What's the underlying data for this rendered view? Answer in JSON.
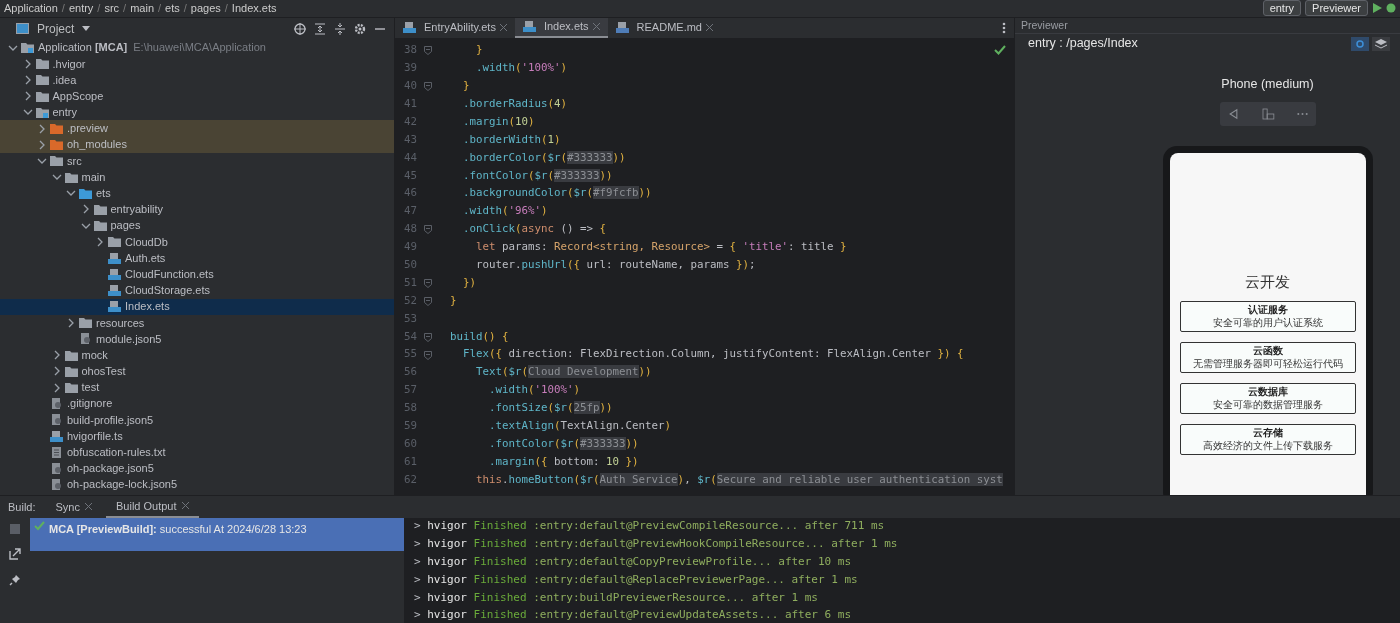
{
  "top_bar": {
    "separator": "/",
    "breadcrumb": [
      "Application",
      "entry",
      "src",
      "main",
      "ets",
      "pages",
      "Index.ets"
    ],
    "run_config": "entry",
    "device": "Previewer"
  },
  "project_panel": {
    "title": "Project",
    "tree": [
      {
        "label": "Application **[MCA]**",
        "path": "E:\\huawei\\MCA\\Application",
        "kind": "module",
        "expanded": true,
        "selected": false,
        "children": [
          {
            "label": ".hvigor",
            "kind": "folder",
            "expanded": false,
            "selected": false
          },
          {
            "label": ".idea",
            "kind": "folder",
            "expanded": false,
            "selected": false
          },
          {
            "label": "AppScope",
            "kind": "folder",
            "expanded": false,
            "selected": false
          },
          {
            "label": "entry",
            "kind": "module",
            "expanded": true,
            "selected": false,
            "children": [
              {
                "label": ".preview",
                "kind": "excluded",
                "expanded": false,
                "selected": false
              },
              {
                "label": "oh_modules",
                "kind": "excluded",
                "expanded": false,
                "selected": false
              },
              {
                "label": "src",
                "kind": "folder",
                "expanded": true,
                "selected": false,
                "children": [
                  {
                    "label": "main",
                    "kind": "folder",
                    "expanded": true,
                    "selected": false,
                    "children": [
                      {
                        "label": "ets",
                        "kind": "source",
                        "expanded": true,
                        "selected": false,
                        "children": [
                          {
                            "label": "entryability",
                            "kind": "folder",
                            "expanded": false,
                            "selected": false
                          },
                          {
                            "label": "pages",
                            "kind": "folder",
                            "expanded": true,
                            "selected": false,
                            "children": [
                              {
                                "label": "CloudDb",
                                "kind": "folder",
                                "expanded": false,
                                "selected": false
                              },
                              {
                                "label": "Auth.ets",
                                "kind": "code",
                                "selected": false
                              },
                              {
                                "label": "CloudFunction.ets",
                                "kind": "code",
                                "selected": false
                              },
                              {
                                "label": "CloudStorage.ets",
                                "kind": "code",
                                "selected": false
                              },
                              {
                                "label": "Index.ets",
                                "kind": "code",
                                "selected": true
                              }
                            ]
                          }
                        ]
                      },
                      {
                        "label": "resources",
                        "kind": "folder",
                        "expanded": false,
                        "selected": false
                      },
                      {
                        "label": "module.json5",
                        "kind": "config",
                        "selected": false
                      }
                    ]
                  },
                  {
                    "label": "mock",
                    "kind": "folder",
                    "expanded": false,
                    "selected": false
                  },
                  {
                    "label": "ohosTest",
                    "kind": "folder",
                    "expanded": false,
                    "selected": false
                  },
                  {
                    "label": "test",
                    "kind": "folder",
                    "expanded": false,
                    "selected": false
                  }
                ]
              },
              {
                "label": ".gitignore",
                "kind": "config",
                "selected": false
              },
              {
                "label": "build-profile.json5",
                "kind": "config",
                "selected": false
              },
              {
                "label": "hvigorfile.ts",
                "kind": "code",
                "selected": false
              },
              {
                "label": "obfuscation-rules.txt",
                "kind": "text",
                "selected": false
              },
              {
                "label": "oh-package.json5",
                "kind": "config",
                "selected": false
              },
              {
                "label": "oh-package-lock.json5",
                "kind": "config",
                "selected": false
              }
            ]
          }
        ]
      }
    ]
  },
  "editor": {
    "tabs": [
      {
        "label": "EntryAbility.ets",
        "kind": "code",
        "selected": false
      },
      {
        "label": "Index.ets",
        "kind": "code",
        "selected": true
      },
      {
        "label": "README.md",
        "kind": "markdown",
        "selected": false
      }
    ],
    "lines": [
      {
        "number": "38",
        "fold": true,
        "tokens": [
          {
            "kind": "bracket",
            "text": "      }"
          }
        ]
      },
      {
        "number": "39",
        "fold": false,
        "tokens": [
          {
            "kind": "method",
            "text": "      .width"
          },
          {
            "kind": "bracket",
            "text": "("
          },
          {
            "kind": "string",
            "text": "'100%'"
          },
          {
            "kind": "bracket",
            "text": ")"
          }
        ]
      },
      {
        "number": "40",
        "fold": true,
        "tokens": [
          {
            "kind": "bracket",
            "text": "    }"
          }
        ]
      },
      {
        "number": "41",
        "fold": false,
        "tokens": [
          {
            "kind": "method",
            "text": "    .borderRadius"
          },
          {
            "kind": "bracket",
            "text": "("
          },
          {
            "kind": "number",
            "text": "4"
          },
          {
            "kind": "bracket",
            "text": ")"
          }
        ]
      },
      {
        "number": "42",
        "fold": false,
        "tokens": [
          {
            "kind": "method",
            "text": "    .margin"
          },
          {
            "kind": "bracket",
            "text": "("
          },
          {
            "kind": "number",
            "text": "10"
          },
          {
            "kind": "bracket",
            "text": ")"
          }
        ]
      },
      {
        "number": "43",
        "fold": false,
        "tokens": [
          {
            "kind": "method",
            "text": "    .borderWidth"
          },
          {
            "kind": "bracket",
            "text": "("
          },
          {
            "kind": "number",
            "text": "1"
          },
          {
            "kind": "bracket",
            "text": ")"
          }
        ]
      },
      {
        "number": "44",
        "fold": false,
        "tokens": [
          {
            "kind": "method",
            "text": "    .borderColor"
          },
          {
            "kind": "bracket",
            "text": "("
          },
          {
            "kind": "method",
            "text": "$r"
          },
          {
            "kind": "bracket",
            "text": "("
          },
          {
            "kind": "resource",
            "text": "#333333"
          },
          {
            "kind": "bracket",
            "text": "))"
          }
        ]
      },
      {
        "number": "45",
        "fold": false,
        "tokens": [
          {
            "kind": "method",
            "text": "    .fontColor"
          },
          {
            "kind": "bracket",
            "text": "("
          },
          {
            "kind": "method",
            "text": "$r"
          },
          {
            "kind": "bracket",
            "text": "("
          },
          {
            "kind": "resource",
            "text": "#333333"
          },
          {
            "kind": "bracket",
            "text": "))"
          }
        ]
      },
      {
        "number": "46",
        "fold": false,
        "tokens": [
          {
            "kind": "method",
            "text": "    .backgroundColor"
          },
          {
            "kind": "bracket",
            "text": "("
          },
          {
            "kind": "method",
            "text": "$r"
          },
          {
            "kind": "bracket",
            "text": "("
          },
          {
            "kind": "resource",
            "text": "#f9fcfb"
          },
          {
            "kind": "bracket",
            "text": "))"
          }
        ]
      },
      {
        "number": "47",
        "fold": false,
        "tokens": [
          {
            "kind": "method",
            "text": "    .width"
          },
          {
            "kind": "bracket",
            "text": "("
          },
          {
            "kind": "string",
            "text": "'96%'"
          },
          {
            "kind": "bracket",
            "text": ")"
          }
        ]
      },
      {
        "number": "48",
        "fold": true,
        "tokens": [
          {
            "kind": "method",
            "text": "    .onClick"
          },
          {
            "kind": "bracket",
            "text": "("
          },
          {
            "kind": "keyword",
            "text": "async"
          },
          {
            "kind": "plain",
            "text": " () => "
          },
          {
            "kind": "bracket",
            "text": "{"
          }
        ]
      },
      {
        "number": "49",
        "fold": false,
        "tokens": [
          {
            "kind": "keyword",
            "text": "      let"
          },
          {
            "kind": "plain",
            "text": " params: "
          },
          {
            "kind": "type",
            "text": "Record<string, Resource>"
          },
          {
            "kind": "plain",
            "text": " = "
          },
          {
            "kind": "bracket",
            "text": "{ "
          },
          {
            "kind": "string",
            "text": "'title'"
          },
          {
            "kind": "plain",
            "text": ": title "
          },
          {
            "kind": "bracket",
            "text": "}"
          }
        ]
      },
      {
        "number": "50",
        "fold": false,
        "tokens": [
          {
            "kind": "plain",
            "text": "      router."
          },
          {
            "kind": "method",
            "text": "pushUrl"
          },
          {
            "kind": "bracket",
            "text": "({ "
          },
          {
            "kind": "plain",
            "text": "url: routeName, params "
          },
          {
            "kind": "bracket",
            "text": "})"
          },
          {
            "kind": "plain",
            "text": ";"
          }
        ]
      },
      {
        "number": "51",
        "fold": true,
        "tokens": [
          {
            "kind": "bracket",
            "text": "    })"
          }
        ]
      },
      {
        "number": "52",
        "fold": true,
        "tokens": [
          {
            "kind": "bracket",
            "text": "  }"
          }
        ]
      },
      {
        "number": "53",
        "fold": false
      },
      {
        "number": "54",
        "fold": true,
        "tokens": [
          {
            "kind": "method",
            "text": "  build"
          },
          {
            "kind": "bracket",
            "text": "() {"
          }
        ]
      },
      {
        "number": "55",
        "fold": true,
        "tokens": [
          {
            "kind": "method",
            "text": "    Flex"
          },
          {
            "kind": "bracket",
            "text": "({ "
          },
          {
            "kind": "plain",
            "text": "direction: FlexDirection.Column, justifyContent: FlexAlign.Center "
          },
          {
            "kind": "bracket",
            "text": "}) {"
          }
        ]
      },
      {
        "number": "56",
        "fold": false,
        "tokens": [
          {
            "kind": "method",
            "text": "      Text"
          },
          {
            "kind": "bracket",
            "text": "("
          },
          {
            "kind": "method",
            "text": "$r"
          },
          {
            "kind": "bracket",
            "text": "("
          },
          {
            "kind": "resource",
            "text": "Cloud Development"
          },
          {
            "kind": "bracket",
            "text": "))"
          }
        ]
      },
      {
        "number": "57",
        "fold": false,
        "tokens": [
          {
            "kind": "method",
            "text": "        .width"
          },
          {
            "kind": "bracket",
            "text": "("
          },
          {
            "kind": "string",
            "text": "'100%'"
          },
          {
            "kind": "bracket",
            "text": ")"
          }
        ]
      },
      {
        "number": "58",
        "fold": false,
        "tokens": [
          {
            "kind": "method",
            "text": "        .fontSize"
          },
          {
            "kind": "bracket",
            "text": "("
          },
          {
            "kind": "method",
            "text": "$r"
          },
          {
            "kind": "bracket",
            "text": "("
          },
          {
            "kind": "resource",
            "text": "25fp"
          },
          {
            "kind": "bracket",
            "text": "))"
          }
        ]
      },
      {
        "number": "59",
        "fold": false,
        "tokens": [
          {
            "kind": "method",
            "text": "        .textAlign"
          },
          {
            "kind": "bracket",
            "text": "("
          },
          {
            "kind": "plain",
            "text": "TextAlign.Center"
          },
          {
            "kind": "bracket",
            "text": ")"
          }
        ]
      },
      {
        "number": "60",
        "fold": false,
        "tokens": [
          {
            "kind": "method",
            "text": "        .fontColor"
          },
          {
            "kind": "bracket",
            "text": "("
          },
          {
            "kind": "method",
            "text": "$r"
          },
          {
            "kind": "bracket",
            "text": "("
          },
          {
            "kind": "resource",
            "text": "#333333"
          },
          {
            "kind": "bracket",
            "text": "))"
          }
        ]
      },
      {
        "number": "61",
        "fold": false,
        "tokens": [
          {
            "kind": "method",
            "text": "        .margin"
          },
          {
            "kind": "bracket",
            "text": "({ "
          },
          {
            "kind": "plain",
            "text": "bottom: "
          },
          {
            "kind": "number",
            "text": "10"
          },
          {
            "kind": "bracket",
            "text": " })"
          }
        ]
      },
      {
        "number": "62",
        "fold": false,
        "tokens": [
          {
            "kind": "keyword",
            "text": "      this"
          },
          {
            "kind": "plain",
            "text": "."
          },
          {
            "kind": "method",
            "text": "homeButton"
          },
          {
            "kind": "bracket",
            "text": "("
          },
          {
            "kind": "method",
            "text": "$r"
          },
          {
            "kind": "bracket",
            "text": "("
          },
          {
            "kind": "resource",
            "text": "Auth Service"
          },
          {
            "kind": "bracket",
            "text": ")"
          },
          {
            "kind": "plain",
            "text": ", "
          },
          {
            "kind": "method",
            "text": "$r"
          },
          {
            "kind": "bracket",
            "text": "("
          },
          {
            "kind": "resource",
            "text": "Secure and reliable user authentication syst"
          }
        ]
      }
    ]
  },
  "previewer": {
    "title": "Previewer",
    "route": "entry : /pages/Index",
    "device": "Phone (medium)",
    "app": {
      "heading": "云开发",
      "buttons": [
        {
          "title": "认证服务",
          "desc": "安全可靠的用户认证系统"
        },
        {
          "title": "云函数",
          "desc": "无需管理服务器即可轻松运行代码"
        },
        {
          "title": "云数据库",
          "desc": "安全可靠的数据管理服务"
        },
        {
          "title": "云存储",
          "desc": "高效经济的文件上传下载服务"
        }
      ]
    }
  },
  "build_panel": {
    "label": "Build:",
    "tabs": [
      {
        "label": "Sync",
        "selected": false
      },
      {
        "label": "Build Output",
        "selected": true
      }
    ],
    "result": {
      "text": "**MCA [PreviewBuild]:** successful At 2024/6/28 13:23",
      "selected": true
    },
    "log": [
      {
        "prompt": ">",
        "tool": "hvigor",
        "status": "Finished",
        "task": ":entry:default@PreviewCompileResource... after 711 ms"
      },
      {
        "prompt": ">",
        "tool": "hvigor",
        "status": "Finished",
        "task": ":entry:default@PreviewHookCompileResource... after 1 ms"
      },
      {
        "prompt": ">",
        "tool": "hvigor",
        "status": "Finished",
        "task": ":entry:default@CopyPreviewProfile... after 10 ms"
      },
      {
        "prompt": ">",
        "tool": "hvigor",
        "status": "Finished",
        "task": ":entry:default@ReplacePreviewerPage... after 1 ms"
      },
      {
        "prompt": ">",
        "tool": "hvigor",
        "status": "Finished",
        "task": ":entry:buildPreviewerResource... after 1 ms"
      },
      {
        "prompt": ">",
        "tool": "hvigor",
        "status": "Finished",
        "task": ":entry:default@PreviewUpdateAssets... after 6 ms"
      }
    ]
  }
}
